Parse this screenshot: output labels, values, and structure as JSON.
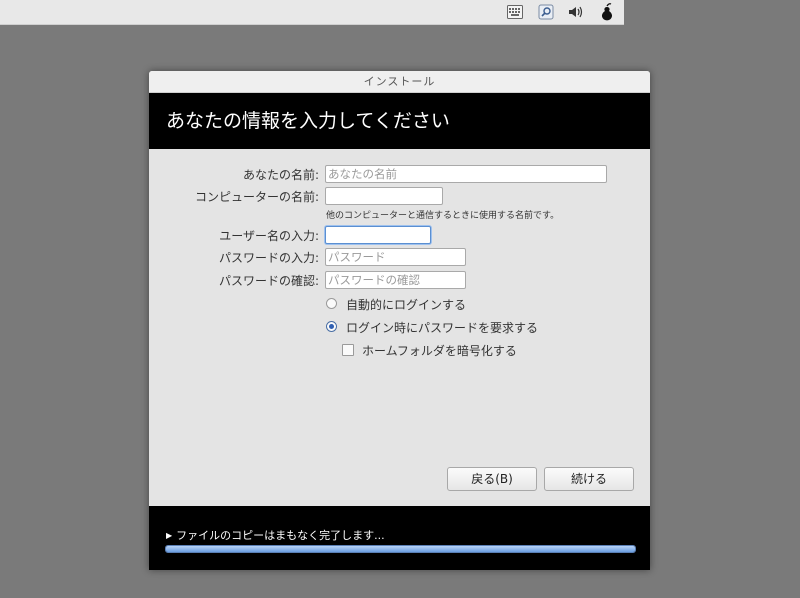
{
  "window": {
    "title": "インストール"
  },
  "header": {
    "title": "あなたの情報を入力してください"
  },
  "form": {
    "name": {
      "label": "あなたの名前:",
      "placeholder": "あなたの名前"
    },
    "computer": {
      "label": "コンピューターの名前:",
      "placeholder": "",
      "hint": "他のコンピューターと通信するときに使用する名前です。"
    },
    "username": {
      "label": "ユーザー名の入力:",
      "placeholder": ""
    },
    "password": {
      "label": "パスワードの入力:",
      "placeholder": "パスワード"
    },
    "confirm": {
      "label": "パスワードの確認:",
      "placeholder": "パスワードの確認"
    }
  },
  "options": {
    "auto_login": {
      "label": "自動的にログインする",
      "checked": false
    },
    "require_password": {
      "label": "ログイン時にパスワードを要求する",
      "checked": true
    },
    "encrypt_home": {
      "label": "ホームフォルダを暗号化する",
      "checked": false
    }
  },
  "buttons": {
    "back": "戻る(B)",
    "continue": "続ける"
  },
  "footer": {
    "status": "ファイルのコピーはまもなく完了します...",
    "progress_percent": 100
  },
  "tray": {
    "icons": [
      "keyboard-icon",
      "network-search-icon",
      "volume-icon",
      "pear-logo-icon"
    ]
  },
  "colors": {
    "header_bg": "#000000",
    "accent": "#2f5fb2",
    "progress": "#6b9ee0"
  }
}
